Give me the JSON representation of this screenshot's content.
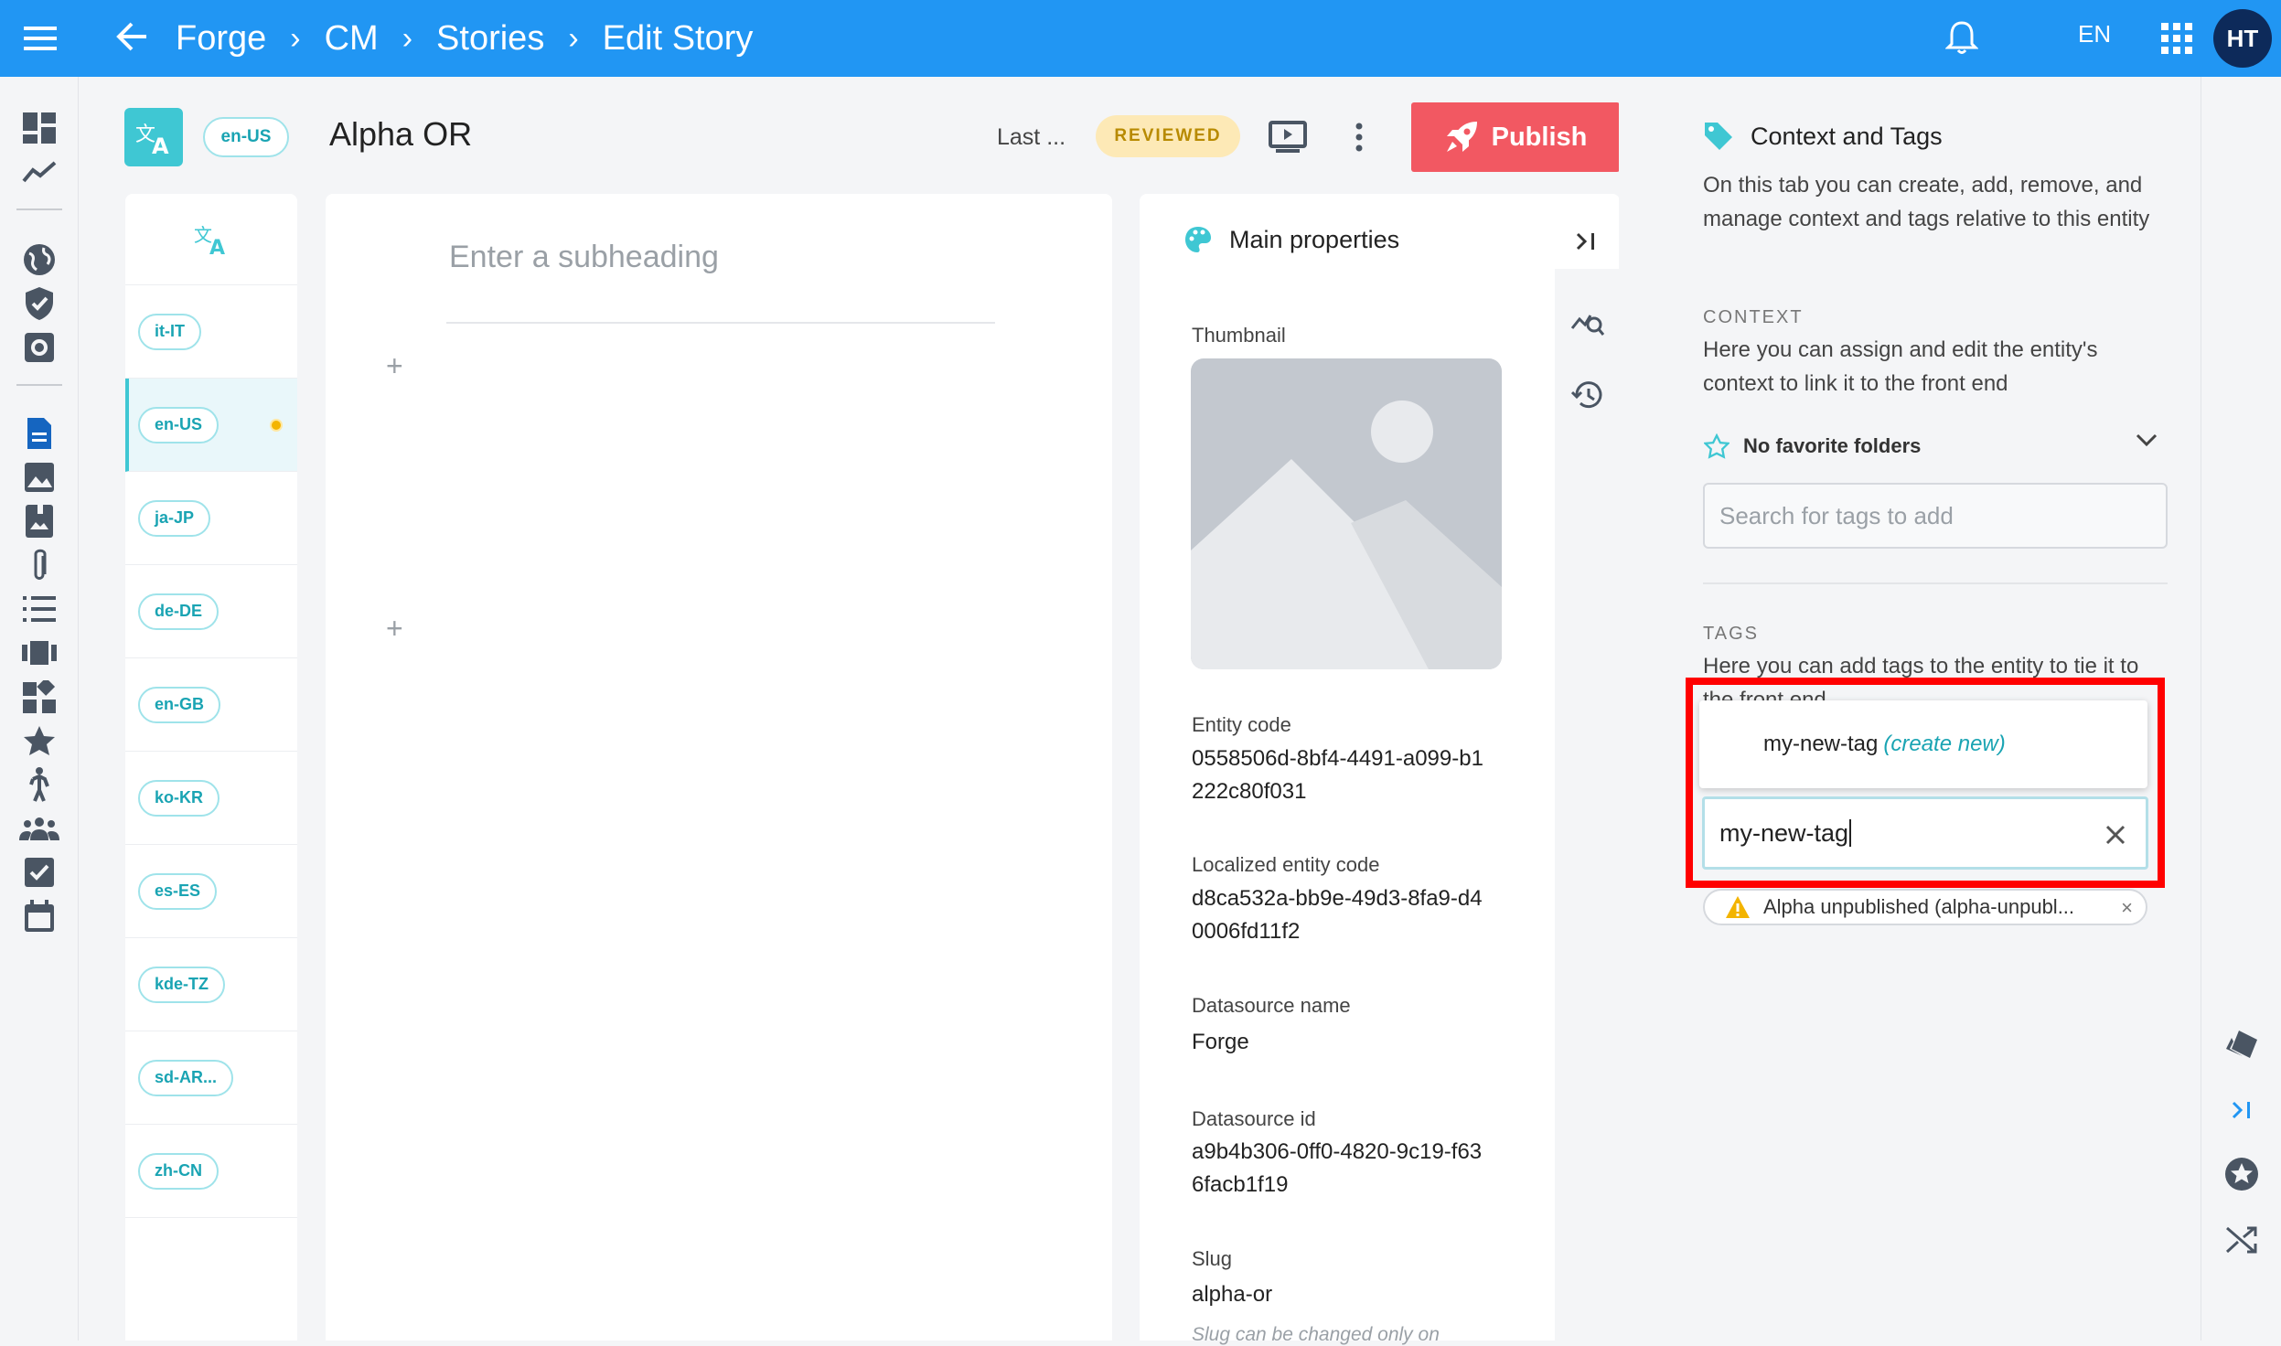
{
  "topbar": {
    "breadcrumbs": [
      "Forge",
      "CM",
      "Stories",
      "Edit Story"
    ],
    "language": "EN",
    "avatar_initials": "HT"
  },
  "entity": {
    "locale": "en-US",
    "title": "Alpha OR",
    "last_label": "Last ...",
    "status": "REVIEWED",
    "publish_label": "Publish"
  },
  "locales": [
    {
      "code": "it-IT"
    },
    {
      "code": "en-US",
      "active": true
    },
    {
      "code": "ja-JP"
    },
    {
      "code": "de-DE"
    },
    {
      "code": "en-GB"
    },
    {
      "code": "ko-KR"
    },
    {
      "code": "es-ES"
    },
    {
      "code": "kde-TZ"
    },
    {
      "code": "sd-AR..."
    },
    {
      "code": "zh-CN"
    }
  ],
  "editor": {
    "subheading_placeholder": "Enter a subheading"
  },
  "properties": {
    "title": "Main properties",
    "thumbnail_label": "Thumbnail",
    "entity_code_label": "Entity code",
    "entity_code": "0558506d-8bf4-4491-a099-b1222c80f031",
    "localized_code_label": "Localized entity code",
    "localized_code": "d8ca532a-bb9e-49d3-8fa9-d40006fd11f2",
    "datasource_name_label": "Datasource name",
    "datasource_name": "Forge",
    "datasource_id_label": "Datasource id",
    "datasource_id": "a9b4b306-0ff0-4820-9c19-f636facb1f19",
    "slug_label": "Slug",
    "slug": "alpha-or",
    "slug_note": "Slug can be changed only on"
  },
  "context": {
    "title": "Context and Tags",
    "description": "On this tab you can create, add, remove, and manage context and tags relative to this entity",
    "context_section": "CONTEXT",
    "context_desc": "Here you can assign and edit the entity's context to link it to the front end",
    "favorites": "No favorite folders",
    "search_placeholder": "Search for tags to add",
    "tags_section": "TAGS",
    "tags_desc": "Here you can add tags to the entity to tie it to the front end",
    "suggestion": "my-new-tag",
    "create_new": "(create new)",
    "tag_input_value": "my-new-tag",
    "existing_tag": "Alpha unpublished (alpha-unpubl..."
  },
  "colors": {
    "topbar": "#2196f3",
    "publish": "#f25862",
    "accent": "#3fc7d3",
    "highlight": "#ff0000"
  }
}
